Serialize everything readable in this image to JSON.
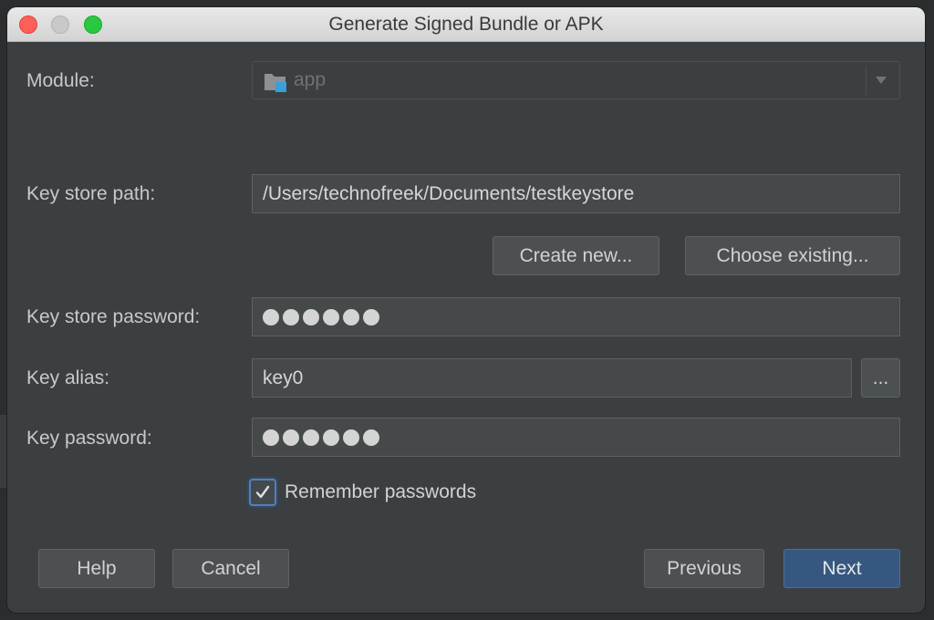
{
  "window": {
    "title": "Generate Signed Bundle or APK"
  },
  "module": {
    "label": "Module:",
    "value": "app",
    "icon": "android-module-folder-icon"
  },
  "keystore": {
    "path_label": "Key store path:",
    "path_value": "/Users/technofreek/Documents/testkeystore",
    "create_new_label": "Create new...",
    "choose_existing_label": "Choose existing...",
    "password_label": "Key store password:",
    "password_mask_count": 6
  },
  "key": {
    "alias_label": "Key alias:",
    "alias_value": "key0",
    "browse_label": "...",
    "password_label": "Key password:",
    "password_mask_count": 6
  },
  "remember": {
    "label": "Remember passwords",
    "checked": true
  },
  "footer": {
    "help_label": "Help",
    "cancel_label": "Cancel",
    "previous_label": "Previous",
    "next_label": "Next"
  },
  "colors": {
    "dialog_bg": "#3c3f41",
    "field_bg": "#45494a",
    "primary_button": "#365880",
    "close": "#fe5f57",
    "maximize": "#28c840"
  }
}
